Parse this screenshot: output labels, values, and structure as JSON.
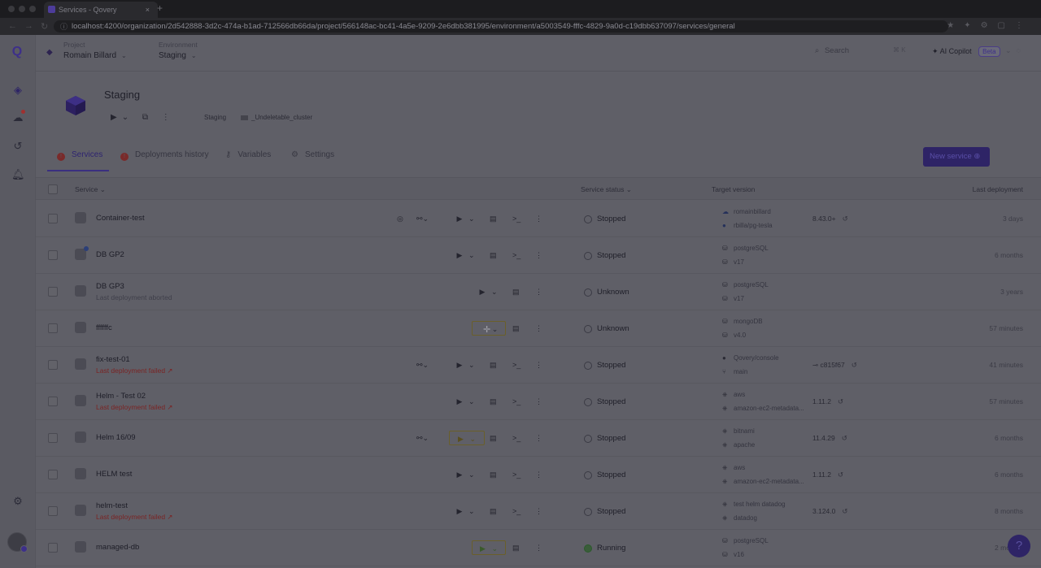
{
  "browser": {
    "tab_title": "Services - Qovery",
    "url": "localhost:4200/organization/2d542888-3d2c-474a-b1ad-712566db66da/project/566148ac-bc41-4a5e-9209-2e6dbb381995/environment/a5003549-fffc-4829-9a0d-c19dbb637097/services/general"
  },
  "topbar": {
    "project_label": "Project",
    "project_value": "Romain Billard",
    "env_label": "Environment",
    "env_value": "Staging",
    "search_placeholder": "Search",
    "search_shortcut": "⌘ K",
    "copilot_label": "AI Copilot",
    "copilot_badge": "Beta"
  },
  "environment": {
    "title": "Staging",
    "env_tag": "Staging",
    "cluster_tag": "_Undeletable_cluster"
  },
  "tabs": [
    {
      "label": "Services",
      "icon": "error-icon",
      "active": true
    },
    {
      "label": "Deployments history",
      "icon": "error-icon",
      "active": false
    },
    {
      "label": "Variables",
      "icon": "key-icon",
      "active": false
    },
    {
      "label": "Settings",
      "icon": "gear-icon",
      "active": false
    }
  ],
  "new_service_label": "New service ⊕",
  "table": {
    "headers": {
      "service": "Service",
      "status": "Service status",
      "target": "Target version",
      "last": "Last deployment"
    },
    "rows": [
      {
        "name": "Container-test",
        "sub": "",
        "status": "Stopped",
        "tv1": "romainbillard",
        "tv2": "rbilla/pg-tesla",
        "version": "8.43.0+",
        "last": "3 days"
      },
      {
        "name": "DB GP2",
        "sub": "",
        "status": "Stopped",
        "tv1": "postgreSQL",
        "tv2": "v17",
        "version": "",
        "last": "6 months"
      },
      {
        "name": "DB GP3",
        "sub": "Last deployment aborted",
        "status": "Unknown",
        "tv1": "postgreSQL",
        "tv2": "v17",
        "version": "",
        "last": "3 years"
      },
      {
        "name": "ffffffc",
        "sub": "",
        "status": "Unknown",
        "tv1": "mongoDB",
        "tv2": "v4.0",
        "version": "",
        "last": "57 minutes"
      },
      {
        "name": "fix-test-01",
        "sub": "Last deployment failed ↗",
        "status": "Stopped",
        "tv1": "Qovery/console",
        "tv2": "main",
        "version": "c815f67",
        "last": "41 minutes"
      },
      {
        "name": "Helm - Test 02",
        "sub": "Last deployment failed ↗",
        "status": "Stopped",
        "tv1": "aws",
        "tv2": "amazon-ec2-metadata...",
        "version": "1.11.2",
        "last": "57 minutes"
      },
      {
        "name": "Helm 16/09",
        "sub": "",
        "status": "Stopped",
        "tv1": "bitnami",
        "tv2": "apache",
        "version": "11.4.29",
        "last": "6 months"
      },
      {
        "name": "HELM test",
        "sub": "",
        "status": "Stopped",
        "tv1": "aws",
        "tv2": "amazon-ec2-metadata...",
        "version": "1.11.2",
        "last": "6 months"
      },
      {
        "name": "helm-test",
        "sub": "Last deployment failed ↗",
        "status": "Stopped",
        "tv1": "test helm datadog",
        "tv2": "datadog",
        "version": "3.124.0",
        "last": "8 months"
      },
      {
        "name": "managed-db",
        "sub": "",
        "status": "Running",
        "tv1": "postgreSQL",
        "tv2": "v16",
        "version": "",
        "last": "2 months"
      }
    ]
  },
  "help_label": "?"
}
